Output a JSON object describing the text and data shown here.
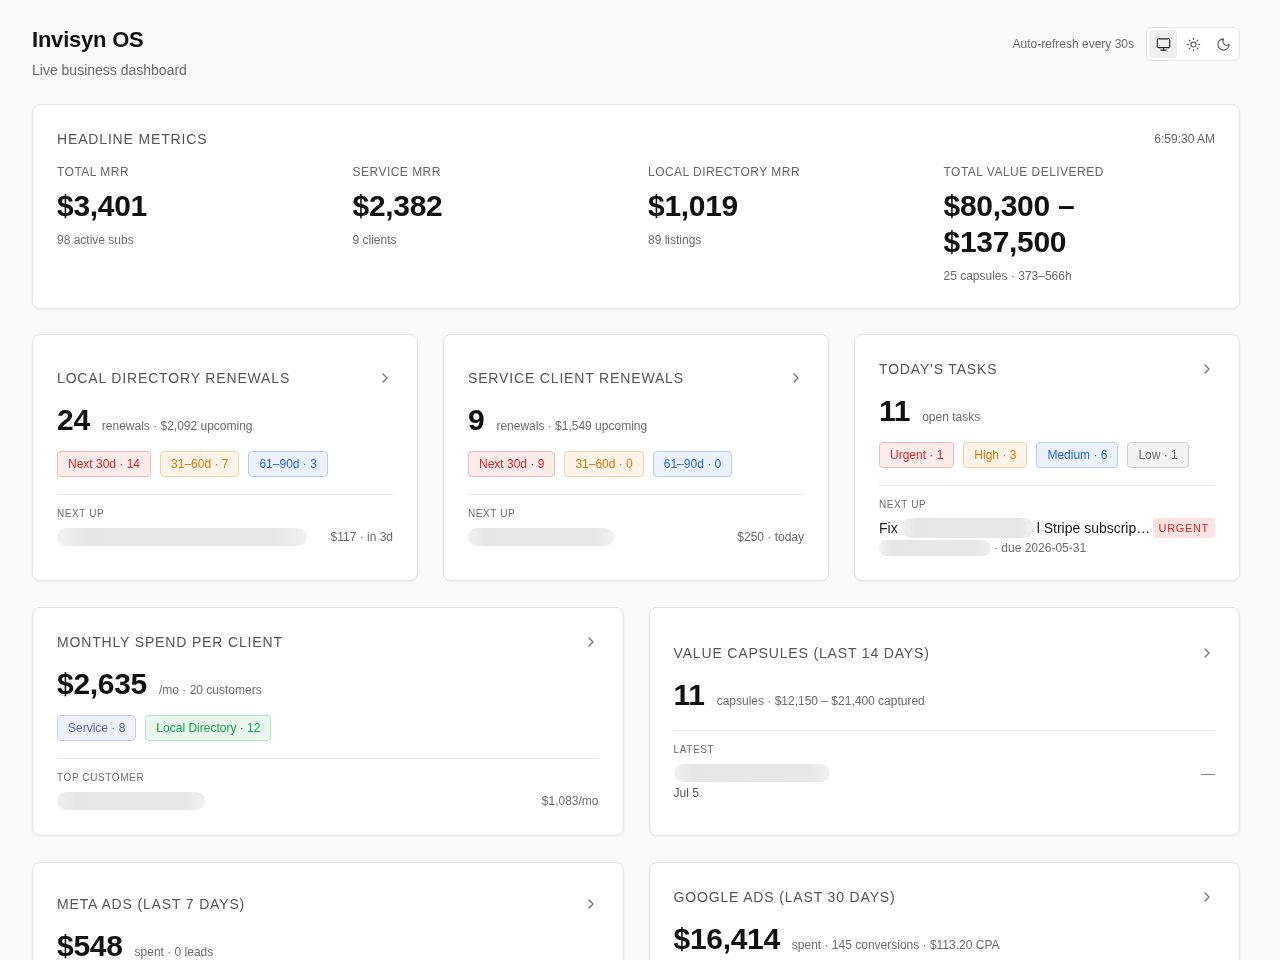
{
  "header": {
    "title": "Invisyn OS",
    "subtitle": "Live business dashboard",
    "refresh_note": "Auto-refresh every 30s",
    "theme_options": [
      {
        "kind": "system",
        "selected": true
      },
      {
        "kind": "light",
        "selected": false
      },
      {
        "kind": "dark",
        "selected": false
      }
    ]
  },
  "headline_metrics": {
    "title": "HEADLINE METRICS",
    "time": "6:59:30 AM",
    "metrics": [
      {
        "label": "TOTAL MRR",
        "value": "$3,401",
        "note": "98 active subs"
      },
      {
        "label": "SERVICE MRR",
        "value": "$2,382",
        "note": "9 clients"
      },
      {
        "label": "LOCAL DIRECTORY MRR",
        "value": "$1,019",
        "note": "89 listings"
      },
      {
        "label": "TOTAL VALUE DELIVERED",
        "value": "$80,300 – $137,500",
        "note": "25 capsules · 373–566h"
      }
    ]
  },
  "card_rows": [
    {
      "cards": [
        {
          "title": "LOCAL DIRECTORY RENEWALS",
          "value": "24",
          "value_note": "renewals · $2,092 upcoming",
          "pills": [
            {
              "label": "Next 30d · 14",
              "color": "#dc2626"
            },
            {
              "label": "31–60d · 7",
              "color": "#d97706"
            },
            {
              "label": "61–90d · 3",
              "color": "#2563eb"
            }
          ],
          "footer": {
            "kind": "amount",
            "label": "NEXT UP",
            "name_blurred": true,
            "amount": "$117 · in 3d"
          }
        },
        {
          "title": "SERVICE CLIENT RENEWALS",
          "value": "9",
          "value_note": "renewals · $1,549 upcoming",
          "pills": [
            {
              "label": "Next 30d · 9",
              "color": "#dc2626"
            },
            {
              "label": "31–60d · 0",
              "color": "#d97706"
            },
            {
              "label": "61–90d · 0",
              "color": "#2563eb"
            }
          ],
          "footer": {
            "kind": "amount",
            "label": "NEXT UP",
            "name_blurred": true,
            "amount": "$250 · today"
          }
        },
        {
          "title": "TODAY'S TASKS",
          "value": "11",
          "value_note": "open tasks",
          "pills": [
            {
              "label": "Urgent · 1",
              "color": "#dc2626"
            },
            {
              "label": "High · 3",
              "color": "#d97706"
            },
            {
              "label": "Medium · 6",
              "color": "#2563eb"
            },
            {
              "label": "Low · 1",
              "color": "#6b6b6b"
            }
          ],
          "footer": {
            "kind": "task",
            "label": "NEXT UP",
            "title_start": "Fix",
            "title_blurred": true,
            "title_end": "l Stripe subscrip…",
            "badge": "URGENT",
            "detail_blurred": true,
            "detail": "· due 2026-05-31"
          }
        }
      ]
    },
    {
      "cards": [
        {
          "title": "MONTHLY SPEND PER CLIENT",
          "value": "$2,635",
          "value_note": "/mo · 20 customers",
          "pills": [
            {
              "label": "Service · 8",
              "color": "#5b5bd6"
            },
            {
              "label": "Local Directory · 12",
              "color": "#16a34a"
            }
          ],
          "footer": {
            "kind": "amount",
            "label": "TOP CUSTOMER",
            "name_blurred": true,
            "amount": "$1,083/mo"
          }
        },
        {
          "title": "VALUE CAPSULES (LAST 14 DAYS)",
          "value": "11",
          "value_note": "capsules · $12,150 – $21,400 captured",
          "footer": {
            "kind": "latest",
            "label": "LATEST",
            "name_blurred": true,
            "trailing": "—",
            "date": "Jul 5"
          }
        }
      ]
    },
    {
      "cards": [
        {
          "title": "META ADS (LAST 7 DAYS)",
          "value": "$548",
          "value_note": "spent · 0 leads"
        },
        {
          "title": "GOOGLE ADS (LAST 30 DAYS)",
          "value": "$16,414",
          "value_note": "spent · 145 conversions · $113.20 CPA"
        }
      ]
    }
  ]
}
